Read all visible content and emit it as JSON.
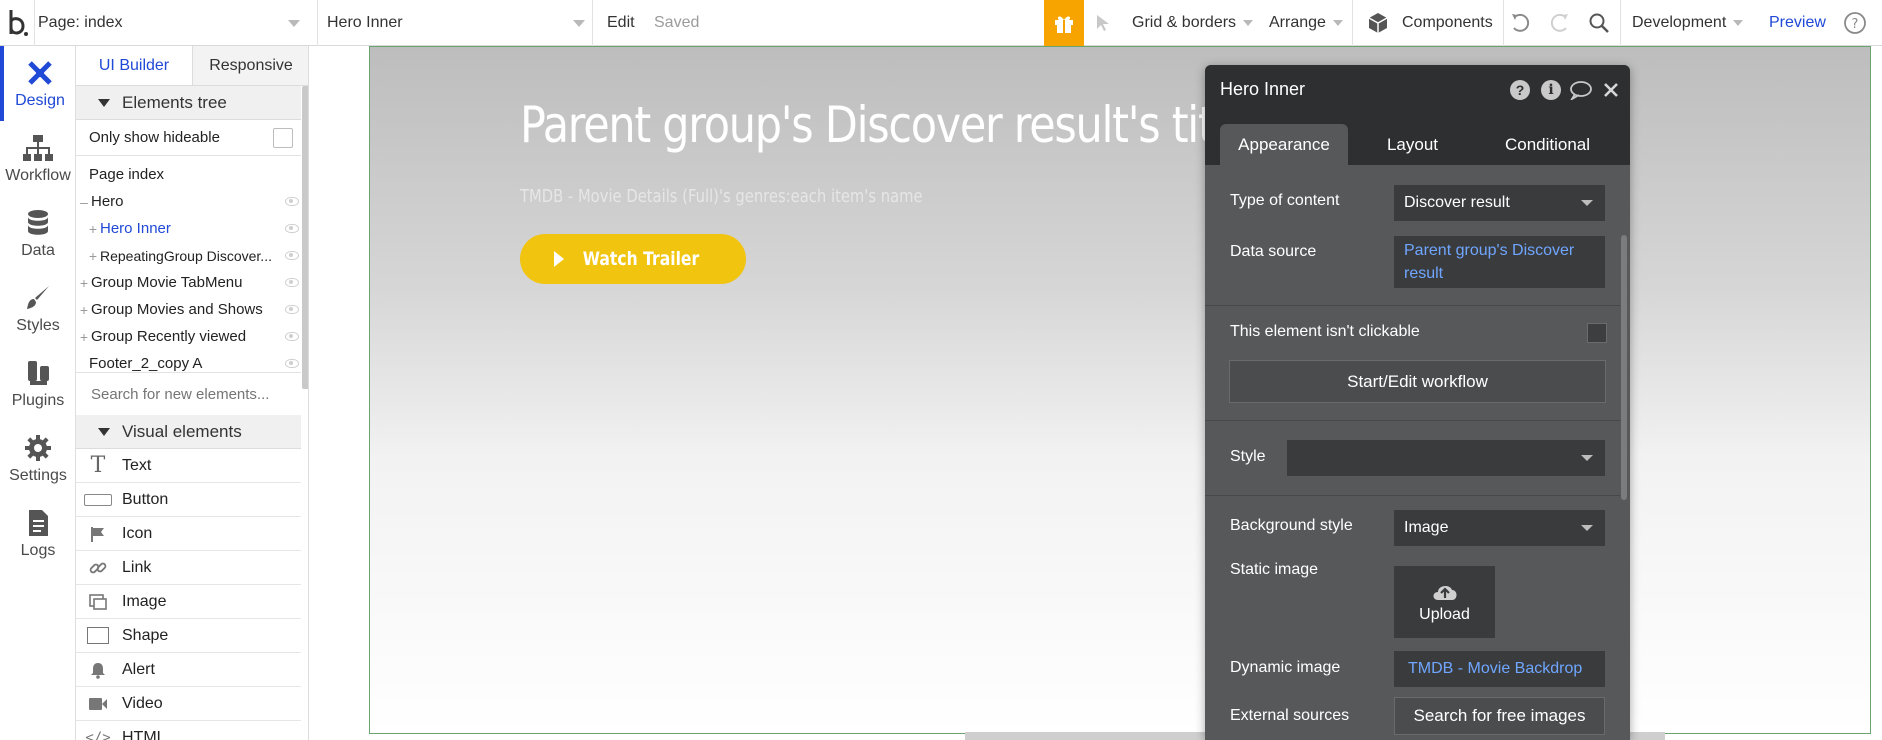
{
  "topbar": {
    "page_selector": "Page: index",
    "element_selector": "Hero Inner",
    "edit_label": "Edit",
    "saved_label": "Saved",
    "grid_borders_label": "Grid & borders",
    "arrange_label": "Arrange",
    "components_label": "Components",
    "environment_label": "Development",
    "preview_label": "Preview",
    "gift_color": "#f7a400"
  },
  "rail": {
    "items": [
      {
        "label": "Design",
        "icon": "design-icon"
      },
      {
        "label": "Workflow",
        "icon": "workflow-icon"
      },
      {
        "label": "Data",
        "icon": "database-icon"
      },
      {
        "label": "Styles",
        "icon": "brush-icon"
      },
      {
        "label": "Plugins",
        "icon": "plug-icon"
      },
      {
        "label": "Settings",
        "icon": "gear-icon"
      },
      {
        "label": "Logs",
        "icon": "document-icon"
      }
    ]
  },
  "palette": {
    "tabs": [
      "UI Builder",
      "Responsive"
    ],
    "elements_tree_header": "Elements tree",
    "only_show_hideable": "Only show hideable",
    "tree": [
      {
        "label": "Page index",
        "prefix": ""
      },
      {
        "label": "Hero",
        "prefix": "–"
      },
      {
        "label": "Hero Inner",
        "prefix": "+"
      },
      {
        "label": "RepeatingGroup Discover...",
        "prefix": "+"
      },
      {
        "label": "Group Movie TabMenu",
        "prefix": "+"
      },
      {
        "label": "Group Movies and Shows",
        "prefix": "+"
      },
      {
        "label": "Group Recently viewed",
        "prefix": "+"
      },
      {
        "label": "Footer_2_copy A",
        "prefix": ""
      }
    ],
    "search_placeholder": "Search for new elements...",
    "visual_elements_header": "Visual elements",
    "visual_elements": [
      {
        "label": "Text",
        "icon": "text-icon"
      },
      {
        "label": "Button",
        "icon": "button-icon"
      },
      {
        "label": "Icon",
        "icon": "flag-icon"
      },
      {
        "label": "Link",
        "icon": "link-icon"
      },
      {
        "label": "Image",
        "icon": "image-icon"
      },
      {
        "label": "Shape",
        "icon": "shape-icon"
      },
      {
        "label": "Alert",
        "icon": "bell-icon"
      },
      {
        "label": "Video",
        "icon": "video-icon"
      },
      {
        "label": "HTML",
        "icon": "code-icon"
      }
    ]
  },
  "canvas": {
    "hero_title": "Parent group's Discover result's title",
    "hero_subtitle": "TMDB - Movie Details (Full)'s genres:each item's name",
    "watch_button": "Watch Trailer",
    "button_color": "#f1c40f"
  },
  "editor": {
    "title": "Hero Inner",
    "tabs": [
      "Appearance",
      "Layout",
      "Conditional"
    ],
    "type_of_content_label": "Type of content",
    "type_of_content_value": "Discover result",
    "data_source_label": "Data source",
    "data_source_value": "Parent group's Discover result",
    "not_clickable_label": "This element isn't clickable",
    "workflow_button": "Start/Edit workflow",
    "style_label": "Style",
    "style_value": "",
    "background_style_label": "Background style",
    "background_style_value": "Image",
    "static_image_label": "Static image",
    "upload_label": "Upload",
    "dynamic_image_label": "Dynamic image",
    "dynamic_image_value": "TMDB - Movie Backdrop",
    "external_sources_label": "External sources",
    "search_images_button": "Search for free images",
    "link_color": "#6fa6ff"
  }
}
